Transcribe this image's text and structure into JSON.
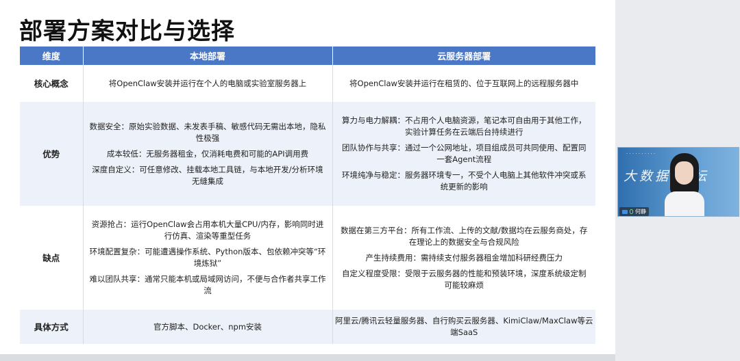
{
  "slide": {
    "title": "部署方案对比与选择",
    "headers": [
      "维度",
      "本地部署",
      "云服务器部署"
    ],
    "rows": [
      {
        "dimension": "核心概念",
        "local": [
          "将OpenClaw安装并运行在个人的电脑或实验室服务器上"
        ],
        "cloud": [
          "将OpenClaw安装并运行在租赁的、位于互联网上的远程服务器中"
        ]
      },
      {
        "dimension": "优势",
        "local": [
          "数据安全：原始实验数据、未发表手稿、敏感代码无需出本地，隐私性极强",
          "成本较低：无服务器租金，仅消耗电费和可能的API调用费",
          "深度自定义：可任意修改、挂载本地工具链，与本地开发/分析环境无缝集成"
        ],
        "cloud": [
          "算力与电力解耦：不占用个人电脑资源，笔记本可自由用于其他工作，实验计算任务在云端后台持续进行",
          "团队协作与共享：通过一个公网地址，项目组成员可共同使用、配置同一套Agent流程",
          "环境纯净与稳定：服务器环境专一，不受个人电脑上其他软件冲突或系统更新的影响"
        ]
      },
      {
        "dimension": "缺点",
        "local": [
          "资源抢占：运行OpenClaw会占用本机大量CPU/内存，影响同时进行仿真、渲染等重型任务",
          "环境配置复杂：可能遭遇操作系统、Python版本、包依赖冲突等“环境炼狱”",
          "难以团队共享：通常只能本机或局域网访问，不便与合作者共享工作流"
        ],
        "cloud": [
          "数据在第三方平台：所有工作流、上传的文献/数据均在云服务商处，存在理论上的数据安全与合规风险",
          "产生持续费用：需持续支付服务器租金增加科研经费压力",
          "自定义程度受限：受限于云服务器的性能和预装环境，深度系统级定制可能较麻烦"
        ]
      },
      {
        "dimension": "具体方式",
        "local": [
          "官方脚本、Docker、npm安装"
        ],
        "cloud": [
          "阿里云/腾讯云轻量服务器、自行购买云服务器、KimiClaw/MaxClaw等云端SaaS"
        ]
      }
    ]
  },
  "video": {
    "banner_text": "大数据 讲坛",
    "participant_name": "何静",
    "mic_icon": "mic-icon",
    "camera_icon": "camera-icon"
  },
  "colors": {
    "header_bg": "#4a78c6",
    "row_shade": "#edf1f9"
  }
}
